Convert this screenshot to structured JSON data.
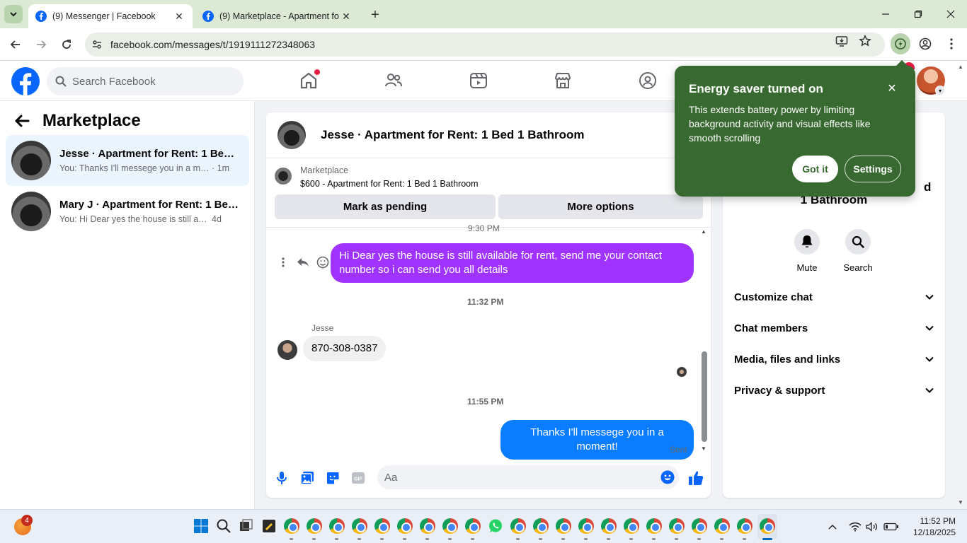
{
  "browser": {
    "tabs": [
      {
        "title": "(9) Messenger | Facebook",
        "active": true
      },
      {
        "title": "(9) Marketplace - Apartment fo",
        "active": false
      }
    ],
    "url": "facebook.com/messages/t/1919111272348063"
  },
  "fb": {
    "search_placeholder": "Search Facebook"
  },
  "sidebar": {
    "title": "Marketplace",
    "conversations": [
      {
        "name": "Jesse · Apartment for Rent: 1 Bed 1...",
        "snippet": "You: Thanks I'll messege you in a mo...",
        "time": "· 1m",
        "active": true
      },
      {
        "name": "Mary J · Apartment for Rent: 1 Bed...",
        "snippet": "You: Hi Dear yes the house is still avail...",
        "time": "4d",
        "active": false
      }
    ]
  },
  "chat": {
    "title": "Jesse · Apartment for Rent: 1 Bed 1 Bathroom",
    "listing_source": "Marketplace",
    "listing_desc": "$600 - Apartment for Rent: 1 Bed 1 Bathroom",
    "mark_pending": "Mark as pending",
    "more_options": "More options",
    "time_fragment": "9:30 PM",
    "messages": {
      "outgoing_1": "Hi Dear yes the house is still available for rent, send me your contact number so i can send you all details",
      "timestamp_1": "11:32 PM",
      "sender": "Jesse",
      "incoming_1": "870-308-0387",
      "timestamp_2": "11:55 PM",
      "outgoing_2": "Thanks I'll messege you in a moment!",
      "status": "Sent"
    },
    "composer_placeholder": "Aa"
  },
  "info": {
    "title_fragment": "d",
    "title_line": "1 Bathroom",
    "mute": "Mute",
    "search": "Search",
    "rows": [
      "Customize chat",
      "Chat members",
      "Media, files and links",
      "Privacy & support"
    ]
  },
  "popup": {
    "title": "Energy saver turned on",
    "body": "This extends battery power by limiting background activity and visual effects like smooth scrolling",
    "got_it": "Got it",
    "settings": "Settings"
  },
  "taskbar": {
    "badge": "4",
    "time": "11:52 PM",
    "date": "12/18/2025"
  },
  "colors": {
    "fb_blue": "#0866ff",
    "messenger_purple": "#a033ff",
    "messenger_blue": "#0a7cff",
    "popup_green": "#386930"
  }
}
